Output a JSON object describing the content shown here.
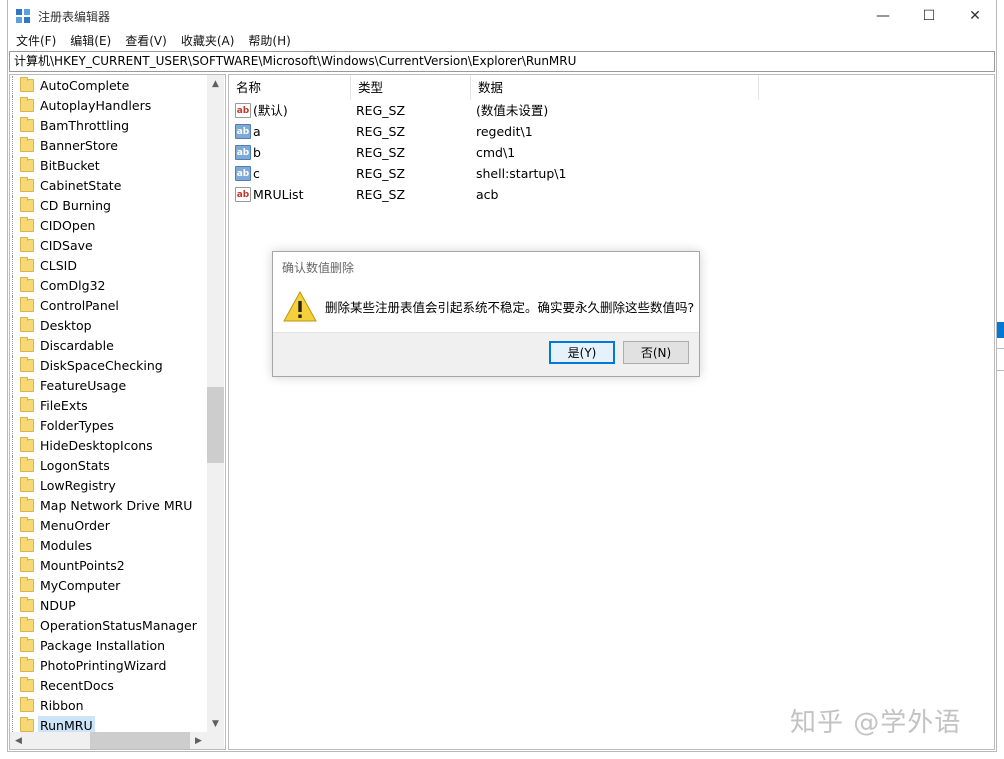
{
  "window": {
    "title": "注册表编辑器",
    "controls": {
      "minimize": "—",
      "maximize": "☐",
      "close": "✕"
    }
  },
  "menu": [
    "文件(F)",
    "编辑(E)",
    "查看(V)",
    "收藏夹(A)",
    "帮助(H)"
  ],
  "address": "计算机\\HKEY_CURRENT_USER\\SOFTWARE\\Microsoft\\Windows\\CurrentVersion\\Explorer\\RunMRU",
  "tree": {
    "items": [
      "AutoComplete",
      "AutoplayHandlers",
      "BamThrottling",
      "BannerStore",
      "BitBucket",
      "CabinetState",
      "CD Burning",
      "CIDOpen",
      "CIDSave",
      "CLSID",
      "ComDlg32",
      "ControlPanel",
      "Desktop",
      "Discardable",
      "DiskSpaceChecking",
      "FeatureUsage",
      "FileExts",
      "FolderTypes",
      "HideDesktopIcons",
      "LogonStats",
      "LowRegistry",
      "Map Network Drive MRU",
      "MenuOrder",
      "Modules",
      "MountPoints2",
      "MyComputer",
      "NDUP",
      "OperationStatusManager",
      "Package Installation",
      "PhotoPrintingWizard",
      "RecentDocs",
      "Ribbon",
      "RunMRU"
    ],
    "selected": "RunMRU"
  },
  "list": {
    "columns": [
      "名称",
      "类型",
      "数据"
    ],
    "rows": [
      {
        "icon": "string-value-icon",
        "glyph": "ab",
        "name": "(默认)",
        "type": "REG_SZ",
        "data": "(数值未设置)"
      },
      {
        "icon": "selected-value-icon",
        "glyph": "ab",
        "name": "a",
        "type": "REG_SZ",
        "data": "regedit\\1"
      },
      {
        "icon": "selected-value-icon",
        "glyph": "ab",
        "name": "b",
        "type": "REG_SZ",
        "data": "cmd\\1"
      },
      {
        "icon": "selected-value-icon",
        "glyph": "ab",
        "name": "c",
        "type": "REG_SZ",
        "data": "shell:startup\\1"
      },
      {
        "icon": "string-value-icon",
        "glyph": "ab",
        "name": "MRUList",
        "type": "REG_SZ",
        "data": "acb"
      }
    ]
  },
  "dialog": {
    "title": "确认数值删除",
    "message": "删除某些注册表值会引起系统不稳定。确实要永久删除这些数值吗?",
    "yes_label": "是(Y)",
    "no_label": "否(N)"
  },
  "scroll": {
    "up": "▲",
    "down": "▼",
    "left": "◀",
    "right": "▶"
  },
  "watermark": "知乎 @学外语",
  "colors": {
    "accent": "#0078d7",
    "selection": "#cce4f7",
    "dialog_footer": "#f0f0f0"
  }
}
